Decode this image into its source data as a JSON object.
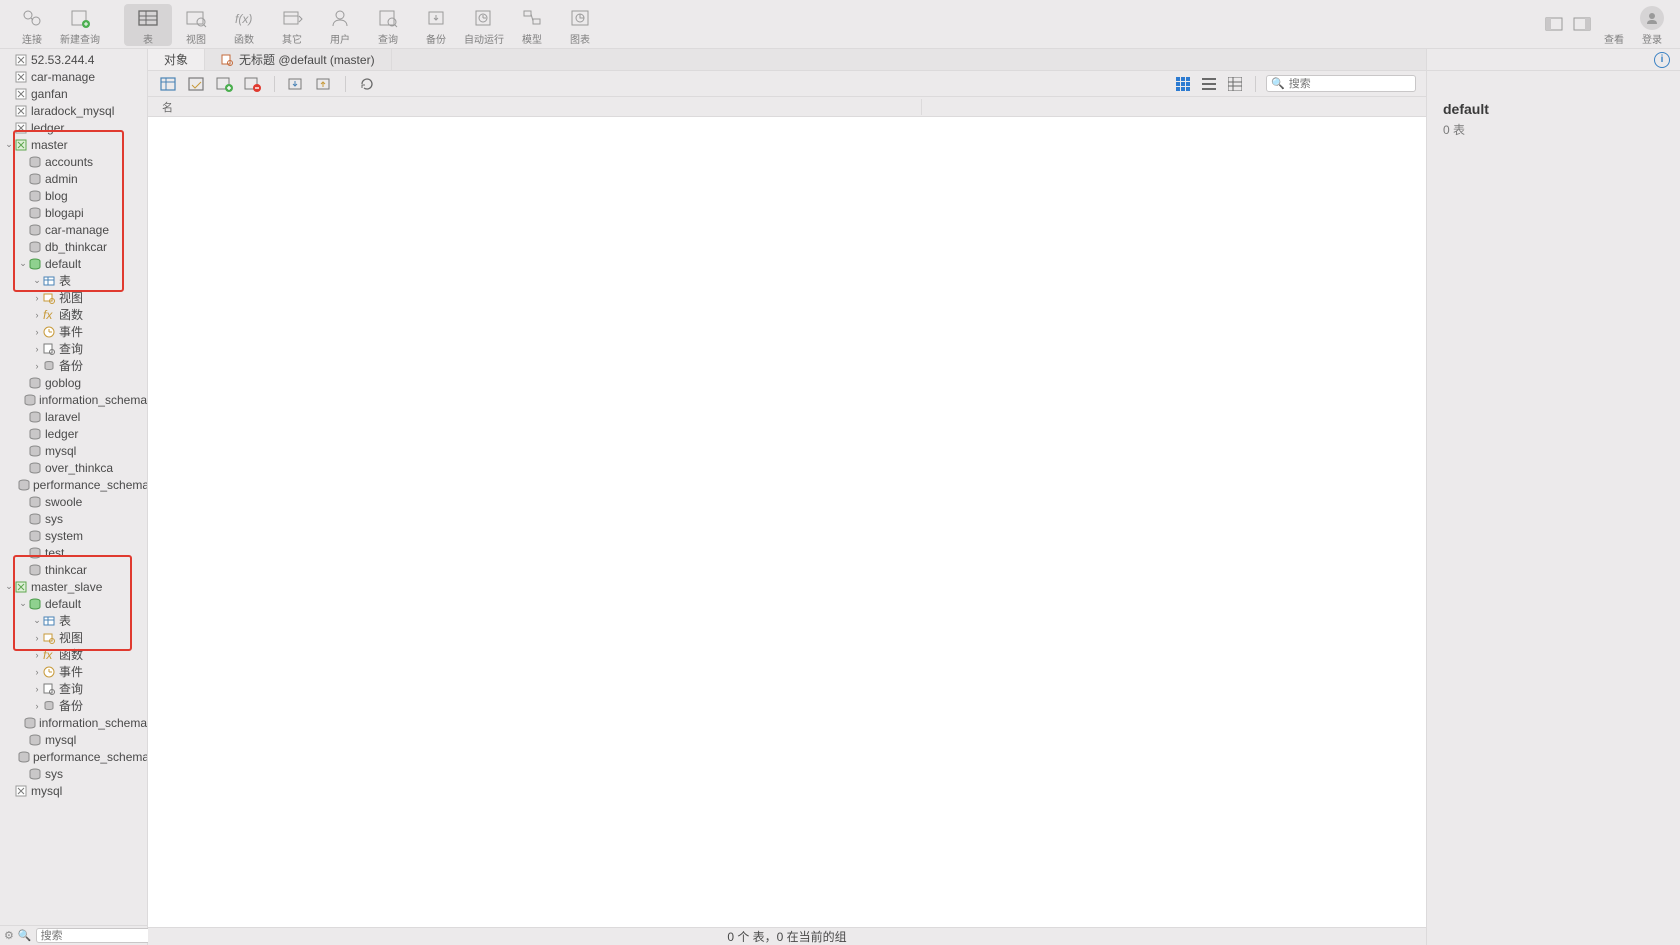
{
  "toolbar": {
    "items": [
      {
        "label": "连接",
        "icon": "plug"
      },
      {
        "label": "新建查询",
        "icon": "newquery"
      },
      {
        "label": "表",
        "icon": "table",
        "active": true
      },
      {
        "label": "视图",
        "icon": "view"
      },
      {
        "label": "函数",
        "icon": "fx"
      },
      {
        "label": "其它",
        "icon": "other"
      },
      {
        "label": "用户",
        "icon": "user"
      },
      {
        "label": "查询",
        "icon": "query"
      },
      {
        "label": "备份",
        "icon": "backup"
      },
      {
        "label": "自动运行",
        "icon": "auto"
      },
      {
        "label": "模型",
        "icon": "model"
      },
      {
        "label": "图表",
        "icon": "chart"
      }
    ],
    "right": {
      "view_label": "查看",
      "login_label": "登录"
    }
  },
  "sidebar": {
    "search_placeholder": "搜索",
    "tree": [
      {
        "depth": 0,
        "arrow": "",
        "icon": "conn",
        "label": "52.53.244.4"
      },
      {
        "depth": 0,
        "arrow": "",
        "icon": "conn",
        "label": "car-manage"
      },
      {
        "depth": 0,
        "arrow": "",
        "icon": "conn",
        "label": "ganfan"
      },
      {
        "depth": 0,
        "arrow": "",
        "icon": "conn",
        "label": "laradock_mysql"
      },
      {
        "depth": 0,
        "arrow": "",
        "icon": "conn",
        "label": "ledger"
      },
      {
        "depth": 0,
        "arrow": "v",
        "icon": "conn-open",
        "label": "master"
      },
      {
        "depth": 1,
        "arrow": "",
        "icon": "db",
        "label": "accounts"
      },
      {
        "depth": 1,
        "arrow": "",
        "icon": "db",
        "label": "admin"
      },
      {
        "depth": 1,
        "arrow": "",
        "icon": "db",
        "label": "blog"
      },
      {
        "depth": 1,
        "arrow": "",
        "icon": "db",
        "label": "blogapi"
      },
      {
        "depth": 1,
        "arrow": "",
        "icon": "db",
        "label": "car-manage"
      },
      {
        "depth": 1,
        "arrow": "",
        "icon": "db",
        "label": "db_thinkcar"
      },
      {
        "depth": 1,
        "arrow": "v",
        "icon": "db-open",
        "label": "default"
      },
      {
        "depth": 2,
        "arrow": "v",
        "icon": "tables",
        "label": "表"
      },
      {
        "depth": 2,
        "arrow": ">",
        "icon": "views",
        "label": "视图"
      },
      {
        "depth": 2,
        "arrow": ">",
        "icon": "fx",
        "label": "函数"
      },
      {
        "depth": 2,
        "arrow": ">",
        "icon": "event",
        "label": "事件"
      },
      {
        "depth": 2,
        "arrow": ">",
        "icon": "query",
        "label": "查询"
      },
      {
        "depth": 2,
        "arrow": ">",
        "icon": "backup",
        "label": "备份"
      },
      {
        "depth": 1,
        "arrow": "",
        "icon": "db",
        "label": "goblog"
      },
      {
        "depth": 1,
        "arrow": "",
        "icon": "db",
        "label": "information_schema"
      },
      {
        "depth": 1,
        "arrow": "",
        "icon": "db",
        "label": "laravel"
      },
      {
        "depth": 1,
        "arrow": "",
        "icon": "db",
        "label": "ledger"
      },
      {
        "depth": 1,
        "arrow": "",
        "icon": "db",
        "label": "mysql"
      },
      {
        "depth": 1,
        "arrow": "",
        "icon": "db",
        "label": "over_thinkca"
      },
      {
        "depth": 1,
        "arrow": "",
        "icon": "db",
        "label": "performance_schema"
      },
      {
        "depth": 1,
        "arrow": "",
        "icon": "db",
        "label": "swoole"
      },
      {
        "depth": 1,
        "arrow": "",
        "icon": "db",
        "label": "sys"
      },
      {
        "depth": 1,
        "arrow": "",
        "icon": "db",
        "label": "system"
      },
      {
        "depth": 1,
        "arrow": "",
        "icon": "db",
        "label": "test"
      },
      {
        "depth": 1,
        "arrow": "",
        "icon": "db",
        "label": "thinkcar"
      },
      {
        "depth": 0,
        "arrow": "v",
        "icon": "conn-open",
        "label": "master_slave"
      },
      {
        "depth": 1,
        "arrow": "v",
        "icon": "db-open",
        "label": "default"
      },
      {
        "depth": 2,
        "arrow": "v",
        "icon": "tables",
        "label": "表"
      },
      {
        "depth": 2,
        "arrow": ">",
        "icon": "views",
        "label": "视图"
      },
      {
        "depth": 2,
        "arrow": ">",
        "icon": "fx",
        "label": "函数"
      },
      {
        "depth": 2,
        "arrow": ">",
        "icon": "event",
        "label": "事件"
      },
      {
        "depth": 2,
        "arrow": ">",
        "icon": "query",
        "label": "查询"
      },
      {
        "depth": 2,
        "arrow": ">",
        "icon": "backup",
        "label": "备份"
      },
      {
        "depth": 1,
        "arrow": "",
        "icon": "db",
        "label": "information_schema"
      },
      {
        "depth": 1,
        "arrow": "",
        "icon": "db",
        "label": "mysql"
      },
      {
        "depth": 1,
        "arrow": "",
        "icon": "db",
        "label": "performance_schema"
      },
      {
        "depth": 1,
        "arrow": "",
        "icon": "db",
        "label": "sys"
      },
      {
        "depth": 0,
        "arrow": "",
        "icon": "conn",
        "label": "mysql"
      }
    ]
  },
  "tabs": [
    {
      "label": "对象",
      "active": true
    },
    {
      "label": "无标题 @default (master)",
      "icon": "query",
      "active": false
    }
  ],
  "subtool_search_placeholder": "搜索",
  "column_header": "名",
  "status": "0 个 表，0 在当前的组",
  "rightpane": {
    "title": "default",
    "sub": "0 表"
  }
}
